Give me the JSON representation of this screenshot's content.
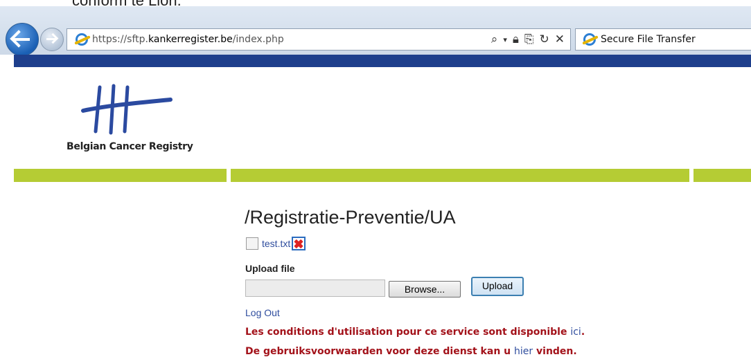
{
  "overlay": {
    "cutoff_text": "conform te Lion."
  },
  "browser": {
    "url_prefix": "https://sftp.",
    "url_host": "kankerregister.be",
    "url_path": "/index.php",
    "tab_title": "Secure File Transfer",
    "address_icons": [
      "search-icon",
      "dropdown-icon",
      "lock-icon",
      "compat-icon",
      "refresh-icon",
      "stop-icon"
    ],
    "accent_color": "#1a5fb4"
  },
  "page": {
    "logo_text": "Belgian Cancer Registry",
    "folder_path": "/Registratie-Preventie/UA",
    "files": [
      {
        "name": "test.txt"
      }
    ],
    "upload_label": "Upload file",
    "browse_label": "Browse...",
    "upload_button": "Upload",
    "logout_label": "Log Out",
    "notice_fr": "Les conditions d'utilisation pour ce service sont disponible ",
    "notice_fr_link": "ici",
    "notice_fr_end": ".",
    "notice_nl": "De gebruiksvoorwaarden voor deze dienst kan u ",
    "notice_nl_link": "hier",
    "notice_nl_end": " vinden.",
    "nav_color": "#1e3f8c",
    "green_color": "#b5cc34",
    "notice_color": "#a3121a"
  }
}
